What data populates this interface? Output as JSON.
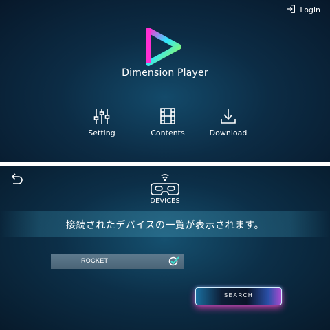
{
  "header": {
    "login_label": "Login",
    "login_icon": "sign-in-icon"
  },
  "app": {
    "title": "Dimension Player",
    "logo_icon": "play-triangle-logo",
    "logo_colors": [
      "#ff2fd2",
      "#2ee6ff",
      "#a8ff3e"
    ]
  },
  "menu": [
    {
      "label": "Setting",
      "icon": "sliders-icon"
    },
    {
      "label": "Contents",
      "icon": "film-icon"
    },
    {
      "label": "Download",
      "icon": "download-icon"
    }
  ],
  "devices": {
    "back_icon": "back-arrow-icon",
    "headset_icon": "vr-headset-wifi-icon",
    "title": "DEVICES",
    "message": "接続されたデバイスの一覧が表示されます。",
    "list": [
      {
        "name": "ROCKET",
        "status_icon": "check-circle-icon",
        "selected": true
      }
    ],
    "search_label": "SEARCH"
  },
  "colors": {
    "top_background": "#0c2c45",
    "bottom_background": "#0c2f48",
    "device_row": "#56717f",
    "search_glow": "#e13cb4"
  }
}
